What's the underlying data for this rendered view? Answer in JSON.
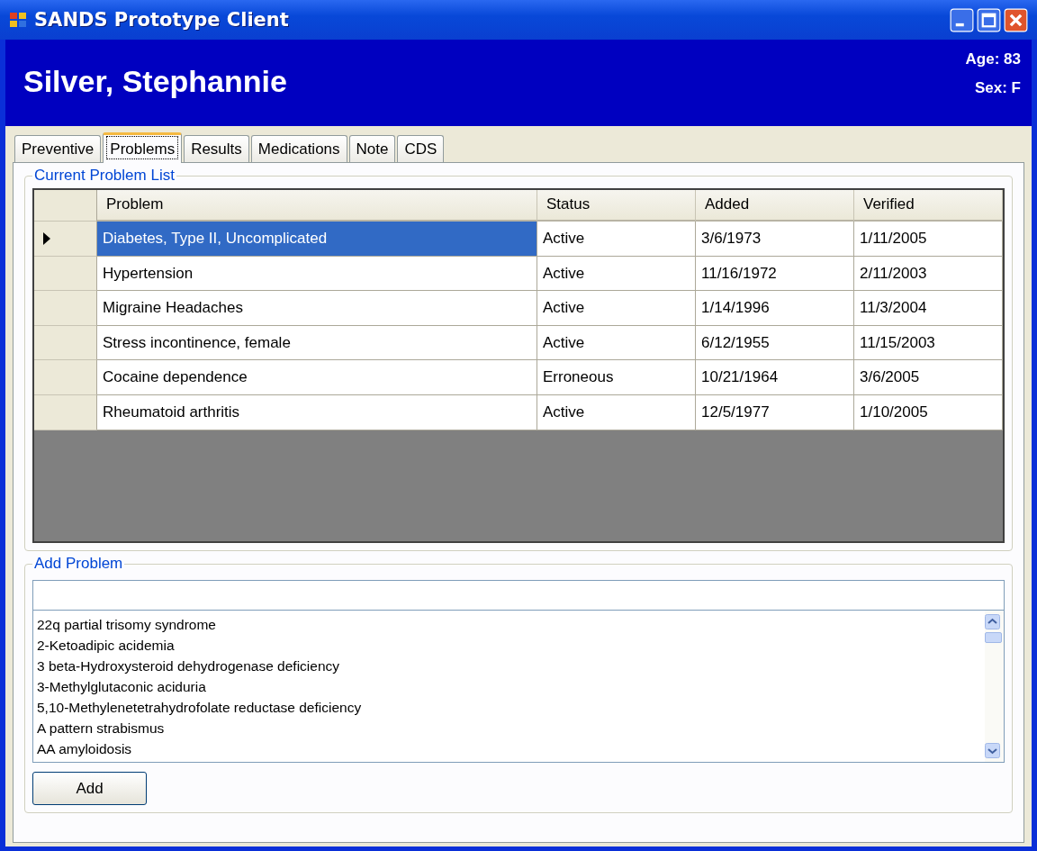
{
  "window": {
    "title": "SANDS Prototype Client"
  },
  "patient": {
    "name": "Silver, Stephannie",
    "age": "Age: 83",
    "sex": "Sex: F"
  },
  "tabs": [
    {
      "label": "Preventive",
      "selected": false
    },
    {
      "label": "Problems",
      "selected": true
    },
    {
      "label": "Results",
      "selected": false
    },
    {
      "label": "Medications",
      "selected": false
    },
    {
      "label": "Note",
      "selected": false
    },
    {
      "label": "CDS",
      "selected": false
    }
  ],
  "problem_list": {
    "title": "Current Problem List",
    "columns": [
      "Problem",
      "Status",
      "Added",
      "Verified"
    ],
    "rows": [
      {
        "cells": [
          "Diabetes, Type II, Uncomplicated",
          "Active",
          "3/6/1973",
          "1/11/2005"
        ],
        "selected": true
      },
      {
        "cells": [
          "Hypertension",
          "Active",
          "11/16/1972",
          "2/11/2003"
        ],
        "selected": false
      },
      {
        "cells": [
          "Migraine Headaches",
          "Active",
          "1/14/1996",
          "11/3/2004"
        ],
        "selected": false
      },
      {
        "cells": [
          "Stress incontinence, female",
          "Active",
          "6/12/1955",
          "11/15/2003"
        ],
        "selected": false
      },
      {
        "cells": [
          "Cocaine dependence",
          "Erroneous",
          "10/21/1964",
          "3/6/2005"
        ],
        "selected": false
      },
      {
        "cells": [
          "Rheumatoid arthritis",
          "Active",
          "12/5/1977",
          "1/10/2005"
        ],
        "selected": false
      }
    ]
  },
  "add_problem": {
    "title": "Add Problem",
    "options": [
      "22q partial trisomy syndrome",
      "2-Ketoadipic acidemia",
      "3 beta-Hydroxysteroid dehydrogenase deficiency",
      "3-Methylglutaconic aciduria",
      "5,10-Methylenetetrahydrofolate reductase deficiency",
      "A pattern strabismus",
      "AA amyloidosis"
    ],
    "button": "Add"
  }
}
